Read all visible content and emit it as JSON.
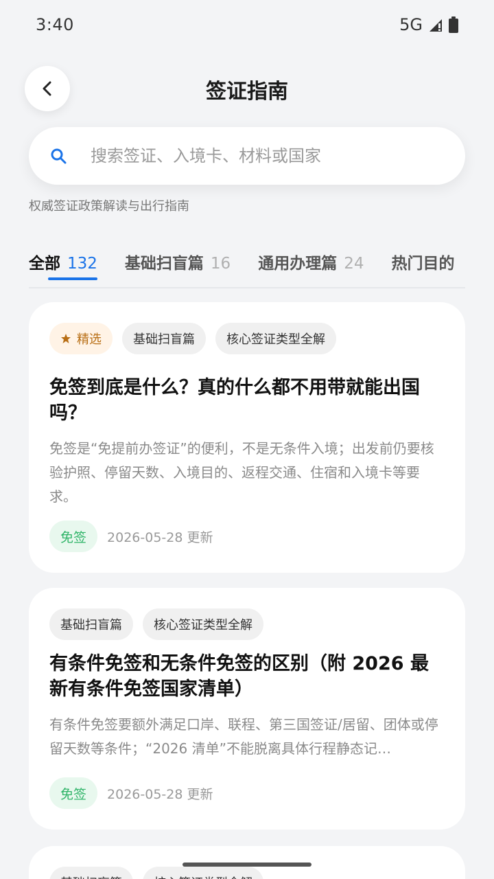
{
  "status": {
    "time": "3:40",
    "network": "5G"
  },
  "header": {
    "title": "签证指南"
  },
  "search": {
    "placeholder": "搜索签证、入境卡、材料或国家"
  },
  "subtitle": "权威签证政策解读与出行指南",
  "tabs": [
    {
      "label": "全部",
      "count": "132",
      "active": true
    },
    {
      "label": "基础扫盲篇",
      "count": "16"
    },
    {
      "label": "通用办理篇",
      "count": "24"
    },
    {
      "label": "热门目的",
      "count": ""
    }
  ],
  "cards": [
    {
      "tags": [
        "精选",
        "基础扫盲篇",
        "核心签证类型全解"
      ],
      "title": "免签到底是什么？真的什么都不用带就能出国吗？",
      "desc": "免签是“免提前办签证”的便利，不是无条件入境；出发前仍要核验护照、停留天数、入境目的、返程交通、住宿和入境卡等要求。",
      "badge": "免签",
      "date": "2026-05-28 更新"
    },
    {
      "tags": [
        "基础扫盲篇",
        "核心签证类型全解"
      ],
      "title": "有条件免签和无条件免签的区别（附 2026 最新有条件免签国家清单）",
      "desc": "有条件免签要额外满足口岸、联程、第三国签证/居留、团体或停留天数等条件；“2026 清单”不能脱离具体行程静态记…",
      "badge": "免签",
      "date": "2026-05-28 更新"
    },
    {
      "tags": [
        "基础扫盲篇",
        "核心签证类型全解"
      ]
    }
  ],
  "colors": {
    "accent": "#1a73e8",
    "green": "#2fb468",
    "featured": "#b86e14"
  }
}
